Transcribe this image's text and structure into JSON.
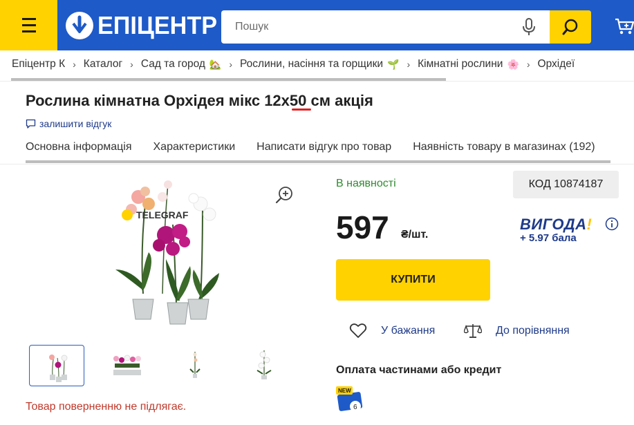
{
  "header": {
    "logo_text": "ЕПІЦЕНТР",
    "logo_reg": "®",
    "search_placeholder": "Пошук"
  },
  "breadcrumbs": [
    {
      "label": "Епіцентр К",
      "emoji": ""
    },
    {
      "label": "Каталог",
      "emoji": ""
    },
    {
      "label": "Сад та город",
      "emoji": "🏡"
    },
    {
      "label": "Рослини, насіння та горщики",
      "emoji": "🌱"
    },
    {
      "label": "Кімнатні рослини",
      "emoji": "🌸"
    },
    {
      "label": "Орхідеї",
      "emoji": ""
    }
  ],
  "product": {
    "title": "Рослина кімнатна Орхідея мікс 12х50 см акція",
    "review_link": "залишити відгук",
    "tabs": [
      "Основна інформація",
      "Характеристики",
      "Написати відгук про товар",
      "Наявність товару в магазинах (192)"
    ],
    "image_watermark": "TELEGRAF",
    "return_note": "Товар поверненню не підлягає."
  },
  "purchase": {
    "stock": "В наявності",
    "code": "КОД 10874187",
    "price": "597",
    "price_unit": "₴/шт.",
    "vigoda_title": "ВИГОДА",
    "vigoda_bang": "!",
    "vigoda_points": "+ 5.97 бала",
    "buy_label": "КУПИТИ",
    "wish_label": "У бажання",
    "compare_label": "До порівняння",
    "credit_title": "Оплата частинами або кредит",
    "credit_badge_new": "NEW",
    "credit_badge_num": "6"
  },
  "colors": {
    "brand_blue": "#1e5ac8",
    "accent_yellow": "#ffd200",
    "stock_green": "#2e8b2e",
    "link_blue": "#1e3a8a",
    "warning_red": "#c0392b"
  }
}
